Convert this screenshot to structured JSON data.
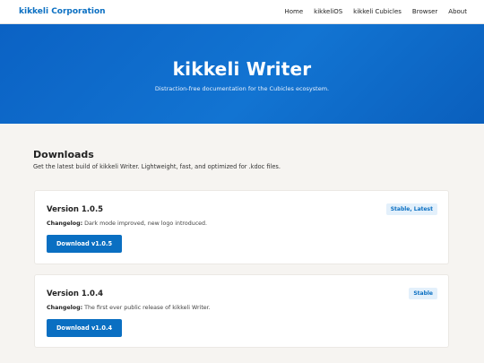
{
  "header": {
    "brand": "kikkeli Corporation",
    "nav": [
      "Home",
      "kikkeliOS",
      "kikkeli Cubicles",
      "Browser",
      "About"
    ]
  },
  "hero": {
    "title": "kikkeli Writer",
    "subtitle": "Distraction-free documentation for the Cubicles ecosystem."
  },
  "downloads": {
    "title": "Downloads",
    "description": "Get the latest build of kikkeli Writer. Lightweight, fast, and optimized for .kdoc files.",
    "releases": [
      {
        "version": "Version 1.0.5",
        "badge": "Stable, Latest",
        "changelog_label": "Changelog:",
        "changelog": "Dark mode improved, new logo introduced.",
        "button": "Download v1.0.5"
      },
      {
        "version": "Version 1.0.4",
        "badge": "Stable",
        "changelog_label": "Changelog:",
        "changelog": "The first ever public release of kikkeli Writer.",
        "button": "Download v1.0.4"
      }
    ]
  },
  "colors": {
    "accent": "#0a6fc2",
    "hero_bg": "#0b62c4",
    "page_bg": "#f6f4f1",
    "badge_bg": "#e3f0fb"
  }
}
